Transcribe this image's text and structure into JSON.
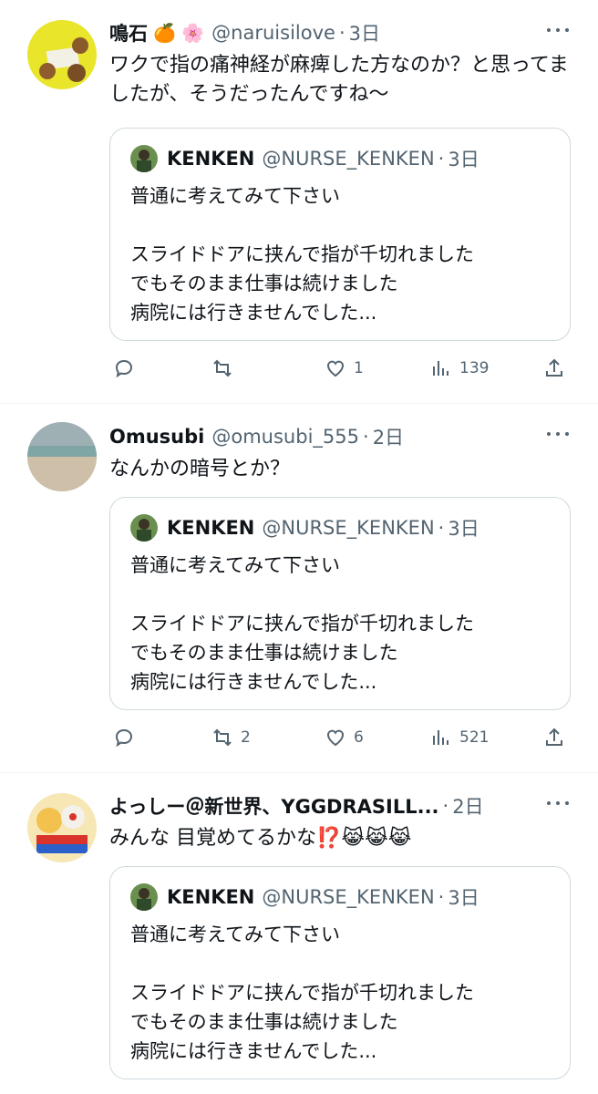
{
  "tweets": [
    {
      "name": "鳴石",
      "name_emojis": "🍊 🌸",
      "handle": "@naruisilove",
      "dot": "·",
      "time": "3日",
      "text": "ワクで指の痛神経が麻痺した方なのか？と思ってましたが、そうだったんですね〜",
      "quote": {
        "name": "KENKEN",
        "handle": "@NURSE_KENKEN",
        "dot": "·",
        "time": "3日",
        "text": "普通に考えてみて下さい\n\nスライドドアに挟んで指が千切れました\nでもそのまま仕事は続けました\n病院には行きませんでした..."
      },
      "reply_count": "",
      "retweet_count": "",
      "like_count": "1",
      "view_count": "139"
    },
    {
      "name": "Omusubi",
      "name_emojis": "",
      "handle": "@omusubi_555",
      "dot": "·",
      "time": "2日",
      "text": "なんかの暗号とか？",
      "quote": {
        "name": "KENKEN",
        "handle": "@NURSE_KENKEN",
        "dot": "·",
        "time": "3日",
        "text": "普通に考えてみて下さい\n\nスライドドアに挟んで指が千切れました\nでもそのまま仕事は続けました\n病院には行きませんでした..."
      },
      "reply_count": "",
      "retweet_count": "2",
      "like_count": "6",
      "view_count": "521"
    },
    {
      "name": "よっしー＠新世界、YGGDRASILL...",
      "name_emojis": "",
      "handle": "",
      "dot": "·",
      "time": "2日",
      "text": "みんな 目覚めてるかな⁉️😹😹😹",
      "quote": {
        "name": "KENKEN",
        "handle": "@NURSE_KENKEN",
        "dot": "·",
        "time": "3日",
        "text": "普通に考えてみて下さい\n\nスライドドアに挟んで指が千切れました\nでもそのまま仕事は続けました\n病院には行きませんでした..."
      }
    }
  ],
  "icons": {
    "reply": "reply-icon",
    "retweet": "retweet-icon",
    "like": "heart-icon",
    "views": "views-icon",
    "share": "share-icon",
    "more": "more-icon"
  }
}
